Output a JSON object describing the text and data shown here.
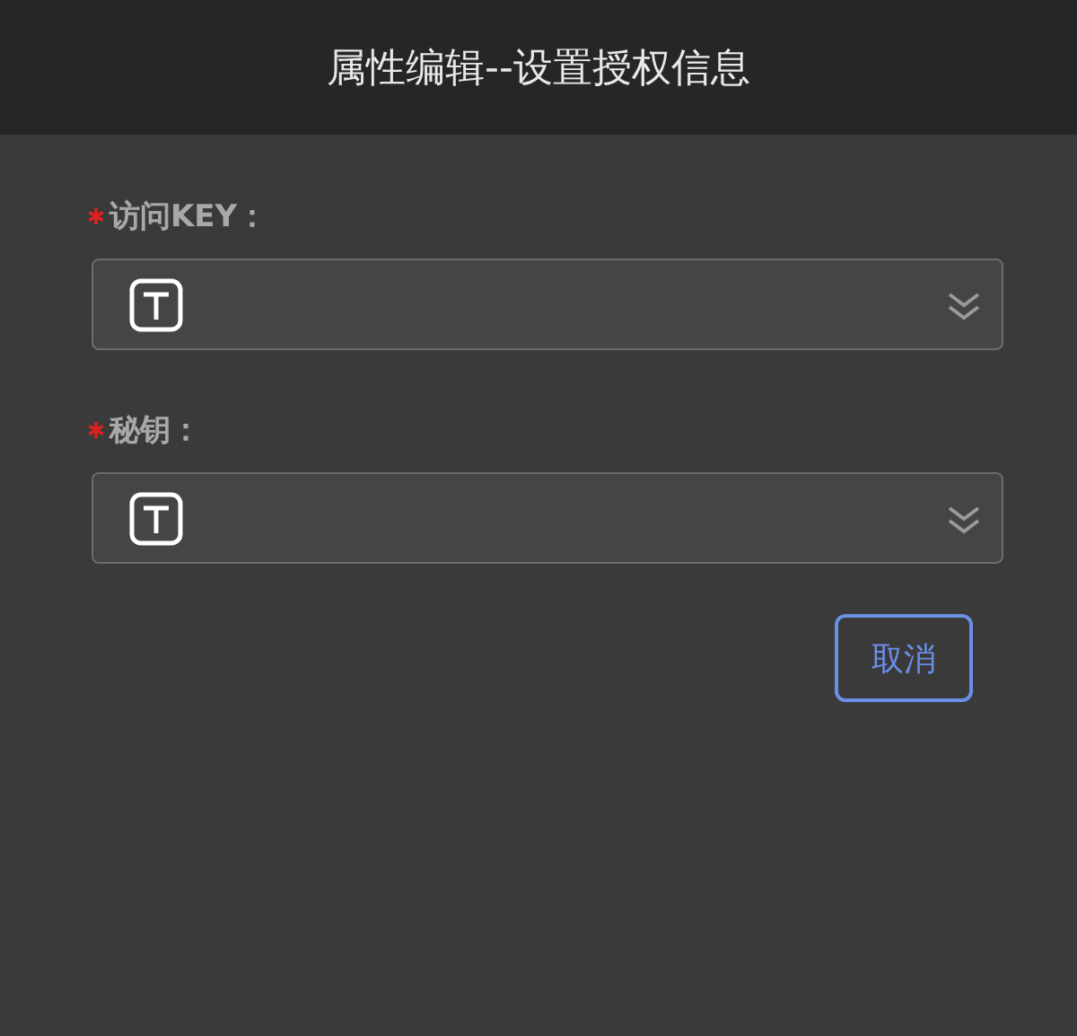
{
  "dialog": {
    "title": "属性编辑--设置授权信息"
  },
  "fields": [
    {
      "label": "访问KEY：",
      "required": true
    },
    {
      "label": "秘钥：",
      "required": true
    }
  ],
  "buttons": [
    {
      "label": "取消"
    }
  ]
}
